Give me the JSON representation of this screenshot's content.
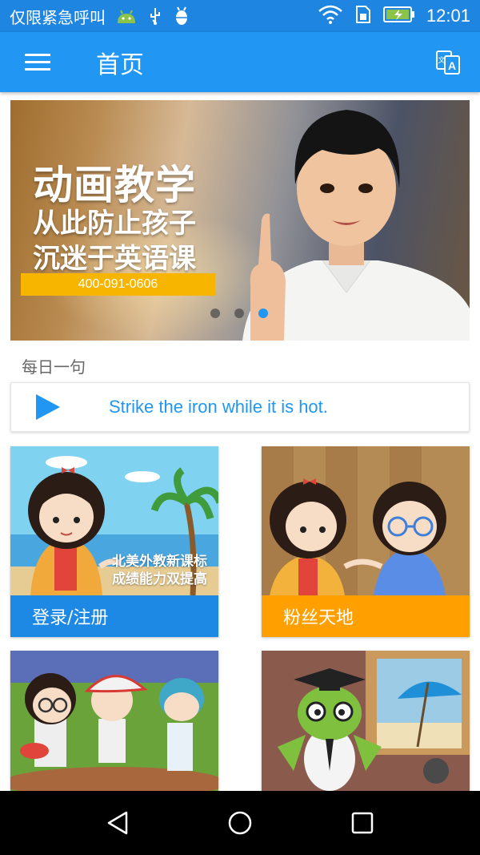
{
  "status_bar": {
    "notification_text": "仅限紧急呼叫",
    "time": "12:01",
    "icons": [
      "android-icon",
      "usb-icon",
      "bug-icon",
      "wifi-icon",
      "sim-icon",
      "battery-charging-icon"
    ]
  },
  "app_bar": {
    "title": "首页",
    "menu_icon": "menu-icon",
    "action_icon": "translate-icon"
  },
  "banner": {
    "headline": "动画教学",
    "line2": "从此防止孩子",
    "line3": "沉迷于英语课",
    "phone": "400-091-0606",
    "active_slide": 3,
    "slide_count": 3
  },
  "daily": {
    "label": "每日一句",
    "sentence": "Strike the iron while it is hot."
  },
  "tiles": [
    {
      "label": "登录/注册",
      "overlay_line1": "北美外教新课标",
      "overlay_line2": "成绩能力双提高",
      "caption_color": "#1e88e5"
    },
    {
      "label": "粉丝天地",
      "caption_color": "#ffa000"
    },
    {
      "label": ""
    },
    {
      "label": ""
    }
  ],
  "colors": {
    "accent": "#2196f3",
    "status_bar": "#1e86e0",
    "banner_phone_bg": "#f7b500"
  },
  "nav_bar": {
    "icons": [
      "back-icon",
      "home-icon",
      "recents-icon"
    ]
  }
}
